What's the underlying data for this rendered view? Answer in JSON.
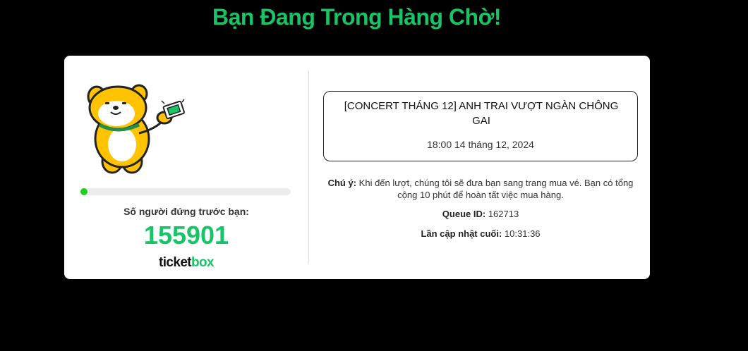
{
  "page": {
    "title": "Bạn Đang Trong Hàng Chờ!"
  },
  "queue": {
    "progress_fraction": 0.035,
    "ahead_label": "Số người đứng trước bạn:",
    "ahead_count": "155901"
  },
  "brand": {
    "part1": "ticket",
    "part2": "box"
  },
  "event": {
    "title": "[CONCERT THÁNG 12] ANH TRAI VƯỢT NGÀN CHÔNG GAI",
    "datetime": "18:00 14 tháng 12, 2024"
  },
  "note": {
    "label": "Chú ý:",
    "text": "Khi đến lượt, chúng tôi sẽ đưa bạn sang trang mua vé. Bạn có tổng cộng 10 phút để hoàn tất việc mua hàng."
  },
  "queue_id": {
    "label": "Queue ID:",
    "value": "162713"
  },
  "last_update": {
    "label": "Lần cập nhật cuối:",
    "value": "10:31:36"
  },
  "colors": {
    "accent": "#19c468",
    "progress": "#18d21c",
    "background": "#000000"
  },
  "icons": {
    "mascot": "dog-mascot-icon",
    "ticket": "ticket-icon"
  }
}
